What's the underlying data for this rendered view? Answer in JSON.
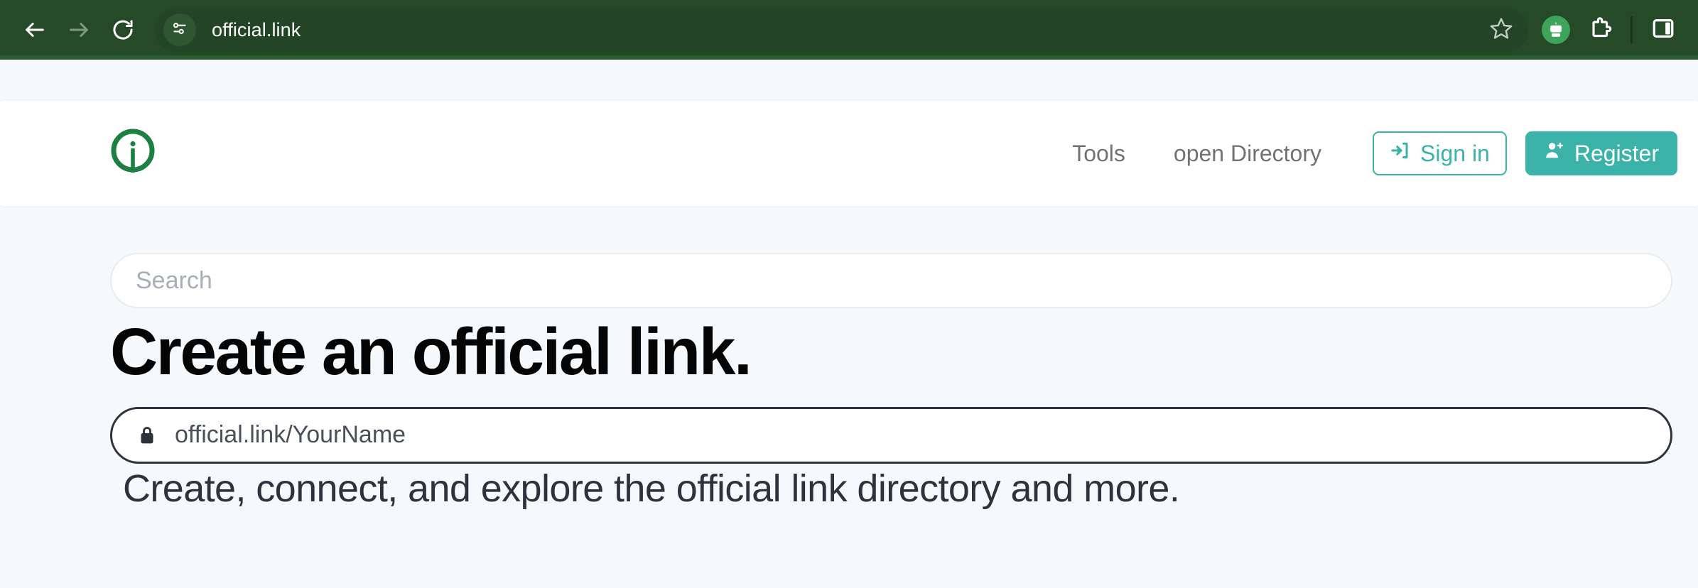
{
  "browser": {
    "back_icon": "back-arrow-icon",
    "forward_icon": "forward-arrow-icon",
    "reload_icon": "reload-icon",
    "site_info_icon": "site-settings-icon",
    "url": "official.link",
    "bookmark_icon": "star-icon",
    "profile_icon": "robot-avatar-icon",
    "extensions_icon": "puzzle-piece-icon",
    "side_panel_icon": "side-panel-icon"
  },
  "header": {
    "logo_icon": "official-link-info-logo",
    "nav": [
      {
        "label": "Tools"
      },
      {
        "label": "open Directory"
      }
    ],
    "sign_in": {
      "label": "Sign in",
      "icon": "sign-in-arrow-icon"
    },
    "register": {
      "label": "Register",
      "icon": "person-add-icon"
    }
  },
  "hero": {
    "search_placeholder": "Search",
    "title": "Create an official link.",
    "url_placeholder": "official.link/YourName",
    "url_lock_icon": "lock-icon",
    "subtitle": "Create, connect, and explore the official link directory and more."
  },
  "colors": {
    "browser_green": "#264a28",
    "brand_green": "#1b8040",
    "accent_teal": "#3bb3a9",
    "page_bg": "#f6f9fc",
    "text_dark": "#2c333d"
  }
}
